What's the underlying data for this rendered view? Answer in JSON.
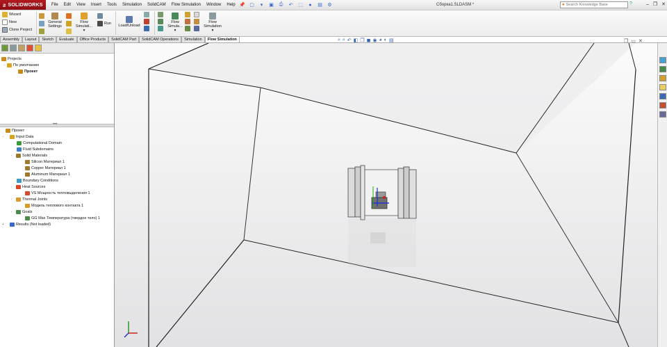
{
  "app": {
    "brand": "SOLIDWORKS",
    "menu": [
      "File",
      "Edit",
      "View",
      "Insert",
      "Tools",
      "Simulation",
      "SolidCAM",
      "Flow Simulation",
      "Window",
      "Help"
    ],
    "doc_title": "Сборка1.SLDASM *",
    "search_placeholder": "Search Knowledge Base"
  },
  "ribbon": {
    "wizard": "Wizard",
    "new": "New",
    "clone": "Clone Project",
    "general_settings": "General Settings",
    "flow_sim1": "Flow Simulati...",
    "run": "Run",
    "load_unload": "Load/Unload",
    "flow_sim2": "Flow Simula...",
    "flow_sim3": "Flow Simulation"
  },
  "tabs": [
    "Assembly",
    "Layout",
    "Sketch",
    "Evaluate",
    "Office Products",
    "SolidCAM Part",
    "SolidCAM Operations",
    "Simulation",
    "Flow Simulation"
  ],
  "active_tab": "Flow Simulation",
  "top_tree": {
    "projects": "Projects",
    "default": "По умолчанию",
    "project": "Проект"
  },
  "tree": [
    {
      "label": "Проект",
      "indent": 0,
      "exp": "",
      "color": "#c98a1a"
    },
    {
      "label": "Input Data",
      "indent": 1,
      "exp": "-",
      "color": "#d9a21f"
    },
    {
      "label": "Computational Domain",
      "indent": 2,
      "exp": "",
      "color": "#3a9a3a"
    },
    {
      "label": "Fluid Subdomains",
      "indent": 2,
      "exp": "",
      "color": "#3a7fc9"
    },
    {
      "label": "Solid Materials",
      "indent": 2,
      "exp": "-",
      "color": "#9a7a2a"
    },
    {
      "label": "Silicon Материал 1",
      "indent": 3,
      "exp": "",
      "color": "#a07830"
    },
    {
      "label": "Copper Материал 1",
      "indent": 3,
      "exp": "",
      "color": "#a07830"
    },
    {
      "label": "Aluminum Материал 1",
      "indent": 3,
      "exp": "",
      "color": "#a07830"
    },
    {
      "label": "Boundary Conditions",
      "indent": 2,
      "exp": "",
      "color": "#3a9ac9"
    },
    {
      "label": "Heat Sources",
      "indent": 2,
      "exp": "-",
      "color": "#d84a2a"
    },
    {
      "label": "VS Мощность тепловыделения 1",
      "indent": 3,
      "exp": "",
      "color": "#d84a2a"
    },
    {
      "label": "Thermal Joints",
      "indent": 2,
      "exp": "-",
      "color": "#d89a2a"
    },
    {
      "label": "Модель теплового контакта 1",
      "indent": 3,
      "exp": "",
      "color": "#d89a2a"
    },
    {
      "label": "Goals",
      "indent": 2,
      "exp": "-",
      "color": "#4a8a4a"
    },
    {
      "label": "GG Max Температура (твердое тело) 1",
      "indent": 3,
      "exp": "",
      "color": "#4a8a4a"
    },
    {
      "label": "Results (Not loaded)",
      "indent": 1,
      "exp": "+",
      "color": "#3a6ac9"
    }
  ],
  "colors": {
    "logo": "#a3141b",
    "viewport_bg": "#ececee",
    "active_tab": "#ffffff"
  }
}
